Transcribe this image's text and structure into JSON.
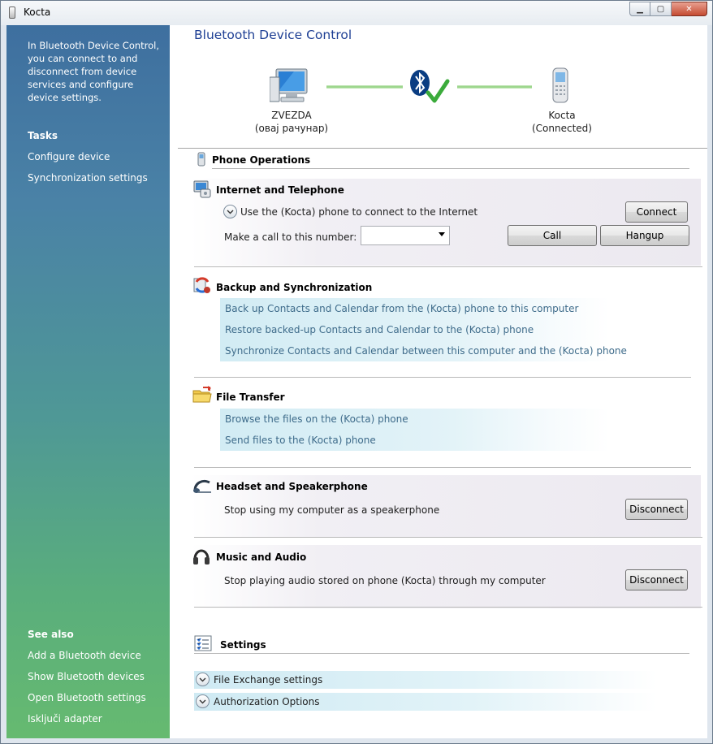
{
  "window": {
    "title": "Kocta",
    "buttons": {
      "minimize": "▁",
      "maximize": "▢",
      "close": "✕"
    }
  },
  "sidebar": {
    "description": "In Bluetooth Device Control, you can connect to and disconnect from device services and configure device settings.",
    "tasks_heading": "Tasks",
    "tasks": [
      "Configure device",
      "Synchronization settings"
    ],
    "see_also_heading": "See also",
    "see_also": [
      "Add a Bluetooth device",
      "Show Bluetooth devices",
      "Open Bluetooth settings",
      "Isključi adapter"
    ]
  },
  "main": {
    "title": "Bluetooth Device Control",
    "computer": {
      "name": "ZVEZDA",
      "subtitle": "(овај рачунар)"
    },
    "phone": {
      "name": "Kocta",
      "status": "(Connected)"
    }
  },
  "phone_operations": {
    "heading": "Phone Operations",
    "internet": {
      "heading": "Internet and Telephone",
      "use_phone": "Use the (Kocta) phone to connect to the Internet",
      "call_label": "Make a call to this number:",
      "call_value": "",
      "connect": "Connect",
      "call": "Call",
      "hangup": "Hangup"
    },
    "backup": {
      "heading": "Backup and Synchronization",
      "links": [
        "Back up Contacts and Calendar from the (Kocta) phone to this computer",
        "Restore backed-up Contacts and Calendar to the (Kocta) phone",
        "Synchronize Contacts and Calendar between this computer and the (Kocta) phone"
      ]
    },
    "file_transfer": {
      "heading": "File Transfer",
      "links": [
        "Browse the files on the (Kocta) phone",
        "Send files to the (Kocta) phone"
      ]
    },
    "headset": {
      "heading": "Headset and Speakerphone",
      "text": "Stop using my computer as a speakerphone",
      "button": "Disconnect"
    },
    "music": {
      "heading": "Music and Audio",
      "text": "Stop playing audio stored on phone (Kocta) through my computer",
      "button": "Disconnect"
    }
  },
  "settings": {
    "heading": "Settings",
    "items": [
      "File Exchange settings",
      "Authorization Options"
    ]
  }
}
